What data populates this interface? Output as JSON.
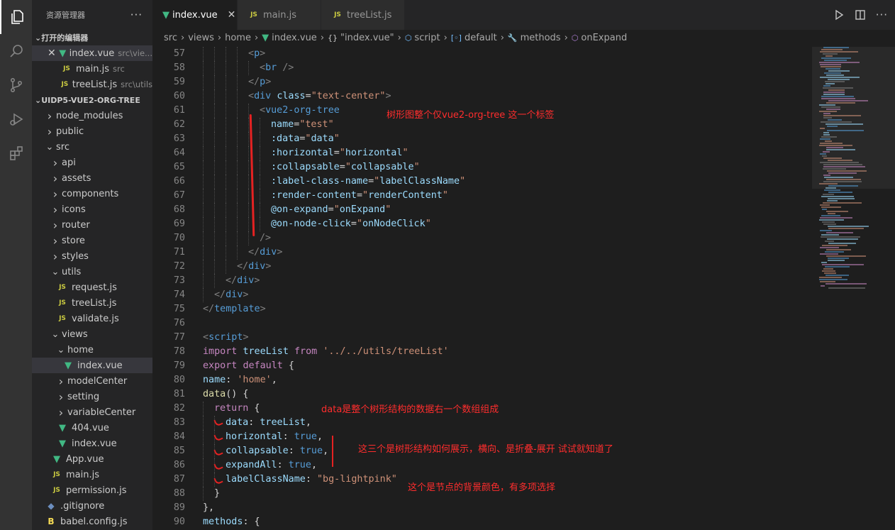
{
  "activity_bar": {
    "items": [
      {
        "icon": "files-icon",
        "active": true
      },
      {
        "icon": "search-icon",
        "active": false
      },
      {
        "icon": "source-control-icon",
        "active": false
      },
      {
        "icon": "run-debug-icon",
        "active": false
      },
      {
        "icon": "extensions-icon",
        "active": false
      }
    ]
  },
  "sidebar": {
    "title": "资源管理器",
    "more": "···",
    "open_editors": {
      "title": "打开的编辑器",
      "items": [
        {
          "name": "index.vue",
          "desc": "src\\vie...",
          "icon": "vue",
          "selected": true,
          "close": "✕"
        },
        {
          "name": "main.js",
          "desc": "src",
          "icon": "js"
        },
        {
          "name": "treeList.js",
          "desc": "src\\utils",
          "icon": "js"
        }
      ]
    },
    "project": {
      "title": "UIDP5-VUE2-ORG-TREE",
      "tree": [
        {
          "name": "node_modules",
          "depth": 0,
          "type": "folder",
          "open": false
        },
        {
          "name": "public",
          "depth": 0,
          "type": "folder",
          "open": false
        },
        {
          "name": "src",
          "depth": 0,
          "type": "folder",
          "open": true
        },
        {
          "name": "api",
          "depth": 1,
          "type": "folder",
          "open": false
        },
        {
          "name": "assets",
          "depth": 1,
          "type": "folder",
          "open": false
        },
        {
          "name": "components",
          "depth": 1,
          "type": "folder",
          "open": false
        },
        {
          "name": "icons",
          "depth": 1,
          "type": "folder",
          "open": false
        },
        {
          "name": "router",
          "depth": 1,
          "type": "folder",
          "open": false
        },
        {
          "name": "store",
          "depth": 1,
          "type": "folder",
          "open": false
        },
        {
          "name": "styles",
          "depth": 1,
          "type": "folder",
          "open": false
        },
        {
          "name": "utils",
          "depth": 1,
          "type": "folder",
          "open": true
        },
        {
          "name": "request.js",
          "depth": 2,
          "type": "js"
        },
        {
          "name": "treeList.js",
          "depth": 2,
          "type": "js"
        },
        {
          "name": "validate.js",
          "depth": 2,
          "type": "js"
        },
        {
          "name": "views",
          "depth": 1,
          "type": "folder",
          "open": true
        },
        {
          "name": "home",
          "depth": 2,
          "type": "folder",
          "open": true
        },
        {
          "name": "index.vue",
          "depth": 3,
          "type": "vue",
          "selected": true
        },
        {
          "name": "modelCenter",
          "depth": 2,
          "type": "folder",
          "open": false
        },
        {
          "name": "setting",
          "depth": 2,
          "type": "folder",
          "open": false
        },
        {
          "name": "variableCenter",
          "depth": 2,
          "type": "folder",
          "open": false
        },
        {
          "name": "404.vue",
          "depth": 2,
          "type": "vue"
        },
        {
          "name": "index.vue",
          "depth": 2,
          "type": "vue"
        },
        {
          "name": "App.vue",
          "depth": 1,
          "type": "vue"
        },
        {
          "name": "main.js",
          "depth": 1,
          "type": "js"
        },
        {
          "name": "permission.js",
          "depth": 1,
          "type": "js"
        },
        {
          "name": ".gitignore",
          "depth": 0,
          "type": "git"
        },
        {
          "name": "babel.config.js",
          "depth": 0,
          "type": "babel"
        }
      ]
    }
  },
  "tabs": [
    {
      "label": "index.vue",
      "icon": "vue",
      "active": true,
      "close": "✕"
    },
    {
      "label": "main.js",
      "icon": "js",
      "active": false
    },
    {
      "label": "treeList.js",
      "icon": "js",
      "active": false
    }
  ],
  "tab_actions": {
    "more": "···"
  },
  "file_icon_labels": {
    "js": "JS",
    "vue": "▼",
    "git": "◆",
    "babel": "B"
  },
  "breadcrumb": [
    {
      "label": "src"
    },
    {
      "label": "views"
    },
    {
      "label": "home"
    },
    {
      "label": "index.vue",
      "icon": "vue",
      "glyph": "▼"
    },
    {
      "label": "\"index.vue\"",
      "icon": "obj",
      "glyph": "{}"
    },
    {
      "label": "script",
      "icon": "sym",
      "glyph": "⬡"
    },
    {
      "label": "default",
      "icon": "sym",
      "glyph": "[◦]"
    },
    {
      "label": "methods",
      "icon": "meth",
      "glyph": "🔧"
    },
    {
      "label": "onExpand",
      "icon": "meth",
      "glyph": "⬡"
    }
  ],
  "code": {
    "lines": [
      {
        "n": "57",
        "indent": 4,
        "tokens": [
          [
            "t-punc",
            "<"
          ],
          [
            "t-tag",
            "p"
          ],
          [
            "t-punc",
            ">"
          ]
        ]
      },
      {
        "n": "58",
        "indent": 5,
        "tokens": [
          [
            "t-punc",
            "<"
          ],
          [
            "t-tag",
            "br"
          ],
          [
            "t-def",
            " "
          ],
          [
            "t-punc",
            "/>"
          ]
        ]
      },
      {
        "n": "59",
        "indent": 4,
        "tokens": [
          [
            "t-punc",
            "</"
          ],
          [
            "t-tag",
            "p"
          ],
          [
            "t-punc",
            ">"
          ]
        ]
      },
      {
        "n": "60",
        "indent": 4,
        "tokens": [
          [
            "t-punc",
            "<"
          ],
          [
            "t-tag",
            "div"
          ],
          [
            "t-def",
            " "
          ],
          [
            "t-attr",
            "class"
          ],
          [
            "t-def",
            "="
          ],
          [
            "t-str",
            "\"text-center\""
          ],
          [
            "t-punc",
            ">"
          ]
        ]
      },
      {
        "n": "61",
        "indent": 5,
        "tokens": [
          [
            "t-punc",
            "<"
          ],
          [
            "t-tag",
            "vue2-org-tree"
          ]
        ]
      },
      {
        "n": "62",
        "indent": 6,
        "tokens": [
          [
            "t-attr",
            "name"
          ],
          [
            "t-def",
            "="
          ],
          [
            "t-str",
            "\"test\""
          ]
        ]
      },
      {
        "n": "63",
        "indent": 6,
        "tokens": [
          [
            "t-attr",
            ":data"
          ],
          [
            "t-def",
            "="
          ],
          [
            "t-str",
            "\""
          ],
          [
            "t-var",
            "data"
          ],
          [
            "t-str",
            "\""
          ]
        ]
      },
      {
        "n": "64",
        "indent": 6,
        "tokens": [
          [
            "t-attr",
            ":horizontal"
          ],
          [
            "t-def",
            "="
          ],
          [
            "t-str",
            "\""
          ],
          [
            "t-var",
            "horizontal"
          ],
          [
            "t-str",
            "\""
          ]
        ]
      },
      {
        "n": "65",
        "indent": 6,
        "tokens": [
          [
            "t-attr",
            ":collapsable"
          ],
          [
            "t-def",
            "="
          ],
          [
            "t-str",
            "\""
          ],
          [
            "t-var",
            "collapsable"
          ],
          [
            "t-str",
            "\""
          ]
        ]
      },
      {
        "n": "66",
        "indent": 6,
        "tokens": [
          [
            "t-attr",
            ":label-class-name"
          ],
          [
            "t-def",
            "="
          ],
          [
            "t-str",
            "\""
          ],
          [
            "t-var",
            "labelClassName"
          ],
          [
            "t-str",
            "\""
          ]
        ]
      },
      {
        "n": "67",
        "indent": 6,
        "tokens": [
          [
            "t-attr",
            ":render-content"
          ],
          [
            "t-def",
            "="
          ],
          [
            "t-str",
            "\""
          ],
          [
            "t-var",
            "renderContent"
          ],
          [
            "t-str",
            "\""
          ]
        ]
      },
      {
        "n": "68",
        "indent": 6,
        "tokens": [
          [
            "t-attr",
            "@on-expand"
          ],
          [
            "t-def",
            "="
          ],
          [
            "t-str",
            "\""
          ],
          [
            "t-var",
            "onExpand"
          ],
          [
            "t-str",
            "\""
          ]
        ]
      },
      {
        "n": "69",
        "indent": 6,
        "tokens": [
          [
            "t-attr",
            "@on-node-click"
          ],
          [
            "t-def",
            "="
          ],
          [
            "t-str",
            "\""
          ],
          [
            "t-var",
            "onNodeClick"
          ],
          [
            "t-str",
            "\""
          ]
        ]
      },
      {
        "n": "70",
        "indent": 5,
        "tokens": [
          [
            "t-punc",
            "/>"
          ]
        ]
      },
      {
        "n": "71",
        "indent": 4,
        "tokens": [
          [
            "t-punc",
            "</"
          ],
          [
            "t-tag",
            "div"
          ],
          [
            "t-punc",
            ">"
          ]
        ]
      },
      {
        "n": "72",
        "indent": 3,
        "tokens": [
          [
            "t-punc",
            "</"
          ],
          [
            "t-tag",
            "div"
          ],
          [
            "t-punc",
            ">"
          ]
        ]
      },
      {
        "n": "73",
        "indent": 2,
        "tokens": [
          [
            "t-punc",
            "</"
          ],
          [
            "t-tag",
            "div"
          ],
          [
            "t-punc",
            ">"
          ]
        ]
      },
      {
        "n": "74",
        "indent": 1,
        "tokens": [
          [
            "t-punc",
            "</"
          ],
          [
            "t-tag",
            "div"
          ],
          [
            "t-punc",
            ">"
          ]
        ]
      },
      {
        "n": "75",
        "indent": 0,
        "tokens": [
          [
            "t-punc",
            "</"
          ],
          [
            "t-tag",
            "template"
          ],
          [
            "t-punc",
            ">"
          ]
        ]
      },
      {
        "n": "76",
        "indent": 0,
        "tokens": []
      },
      {
        "n": "77",
        "indent": 0,
        "tokens": [
          [
            "t-punc",
            "<"
          ],
          [
            "t-tag",
            "script"
          ],
          [
            "t-punc",
            ">"
          ]
        ]
      },
      {
        "n": "78",
        "indent": 0,
        "tokens": [
          [
            "t-kw",
            "import"
          ],
          [
            "t-def",
            " "
          ],
          [
            "t-var",
            "treeList"
          ],
          [
            "t-def",
            " "
          ],
          [
            "t-kw",
            "from"
          ],
          [
            "t-def",
            " "
          ],
          [
            "t-str",
            "'../../utils/treeList'"
          ]
        ]
      },
      {
        "n": "79",
        "indent": 0,
        "tokens": [
          [
            "t-kw",
            "export"
          ],
          [
            "t-def",
            " "
          ],
          [
            "t-kw",
            "default"
          ],
          [
            "t-def",
            " {"
          ]
        ]
      },
      {
        "n": "80",
        "indent": 0,
        "tokens": [
          [
            "t-var",
            "name"
          ],
          [
            "t-def",
            ": "
          ],
          [
            "t-str",
            "'home'"
          ],
          [
            "t-def",
            ","
          ]
        ]
      },
      {
        "n": "81",
        "indent": 0,
        "tokens": [
          [
            "t-fn",
            "data"
          ],
          [
            "t-def",
            "() {"
          ]
        ]
      },
      {
        "n": "82",
        "indent": 1,
        "tokens": [
          [
            "t-kw",
            "return"
          ],
          [
            "t-def",
            " {"
          ]
        ]
      },
      {
        "n": "83",
        "indent": 2,
        "tokens": [
          [
            "t-var",
            "data"
          ],
          [
            "t-def",
            ": "
          ],
          [
            "t-var",
            "treeList"
          ],
          [
            "t-def",
            ","
          ]
        ]
      },
      {
        "n": "84",
        "indent": 2,
        "tokens": [
          [
            "t-var",
            "horizontal"
          ],
          [
            "t-def",
            ": "
          ],
          [
            "t-kb",
            "true"
          ],
          [
            "t-def",
            ","
          ]
        ]
      },
      {
        "n": "85",
        "indent": 2,
        "tokens": [
          [
            "t-var",
            "collapsable"
          ],
          [
            "t-def",
            ": "
          ],
          [
            "t-kb",
            "true"
          ],
          [
            "t-def",
            ","
          ]
        ]
      },
      {
        "n": "86",
        "indent": 2,
        "tokens": [
          [
            "t-var",
            "expandAll"
          ],
          [
            "t-def",
            ": "
          ],
          [
            "t-kb",
            "true"
          ],
          [
            "t-def",
            ","
          ]
        ]
      },
      {
        "n": "87",
        "indent": 2,
        "tokens": [
          [
            "t-var",
            "labelClassName"
          ],
          [
            "t-def",
            ": "
          ],
          [
            "t-str",
            "\"bg-lightpink\""
          ]
        ]
      },
      {
        "n": "88",
        "indent": 1,
        "tokens": [
          [
            "t-def",
            "}"
          ]
        ]
      },
      {
        "n": "89",
        "indent": 0,
        "tokens": [
          [
            "t-def",
            "},"
          ]
        ]
      },
      {
        "n": "90",
        "indent": 0,
        "tokens": [
          [
            "t-var",
            "methods"
          ],
          [
            "t-def",
            ": {"
          ]
        ]
      }
    ]
  },
  "annotations": {
    "tree_tag": "树形图整个仅vue2-org-tree 这一个标签",
    "data_note": "data是整个树形结构的数据右一个数组组成",
    "three_props": "这三个是树形结构如何展示，横向、是折叠-展开 试试就知道了",
    "bg_note": "这个是节点的背景颜色，有多项选择"
  }
}
